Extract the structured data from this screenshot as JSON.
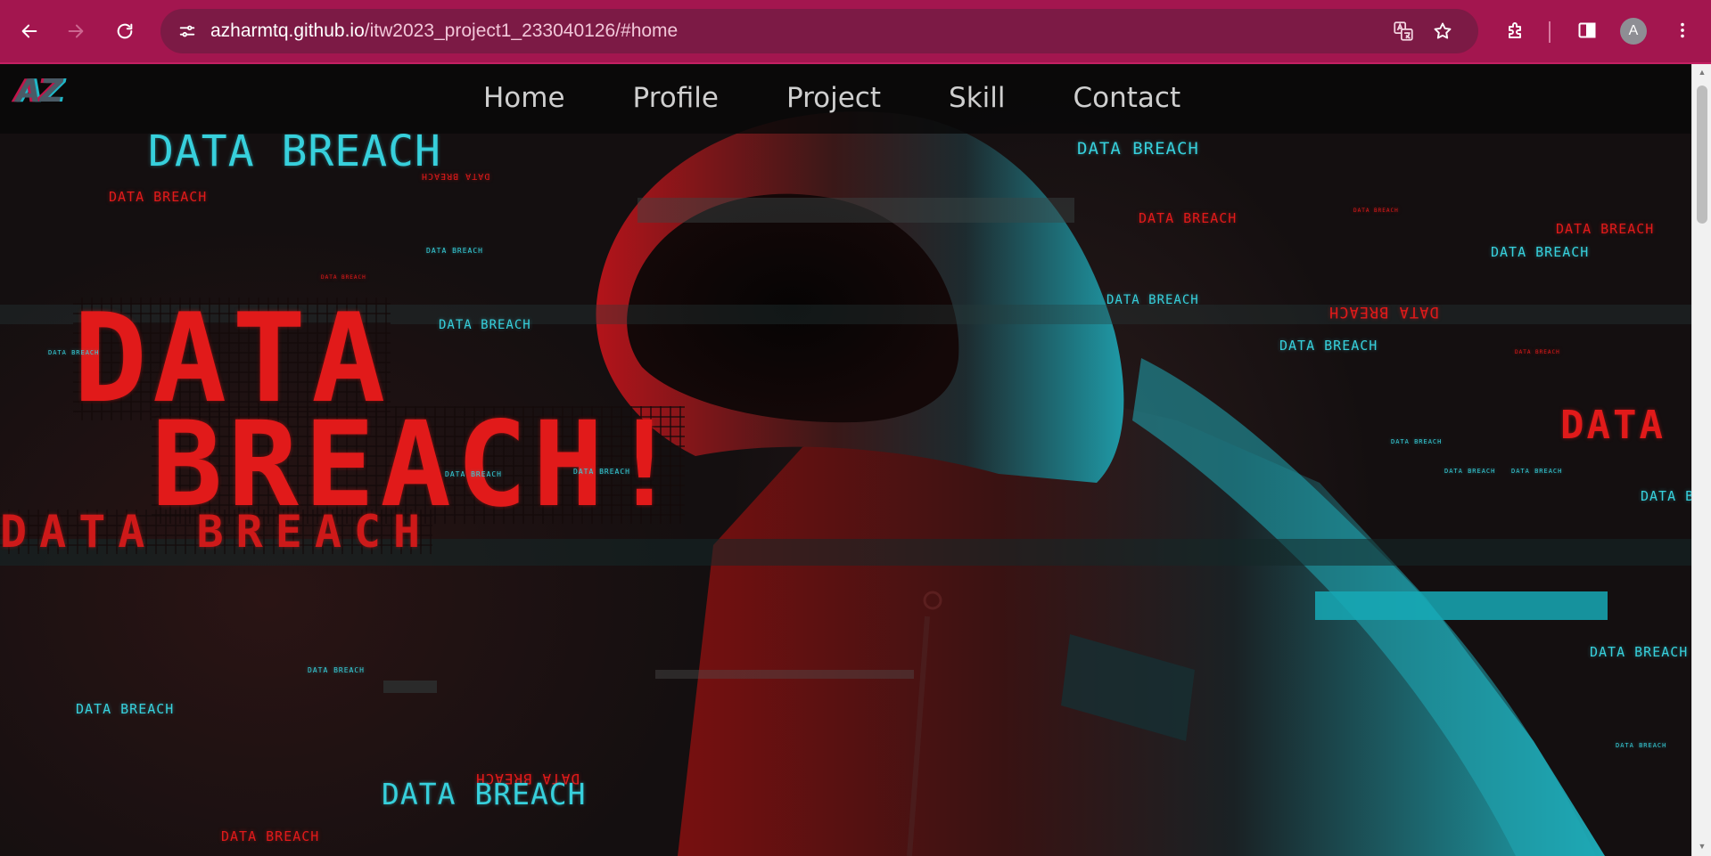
{
  "browser": {
    "url_host": "azharmtq.github.io",
    "url_path": "/itw2023_project1_233040126/#home",
    "avatar_letter": "A",
    "icons": {
      "back": "back-arrow-icon",
      "forward": "forward-arrow-icon",
      "reload": "reload-icon",
      "site_info": "tune-icon",
      "translate": "translate-icon",
      "bookmark": "star-icon",
      "extensions": "puzzle-icon",
      "side_panel": "side-panel-icon",
      "menu": "kebab-menu-icon"
    },
    "colors": {
      "toolbar": "#a3164f",
      "omnibox": "#7c1a45"
    }
  },
  "site": {
    "logo": "AZ",
    "nav": [
      "Home",
      "Profile",
      "Project",
      "Skill",
      "Contact"
    ],
    "hero": {
      "line1": "DATA",
      "line2": "BREACH!"
    },
    "breach_text": "DATA BREACH",
    "breach_short": "DATA",
    "breach_partial": "DATA B",
    "colors": {
      "cyan": "#37d0dc",
      "red": "#e11a1a"
    }
  }
}
